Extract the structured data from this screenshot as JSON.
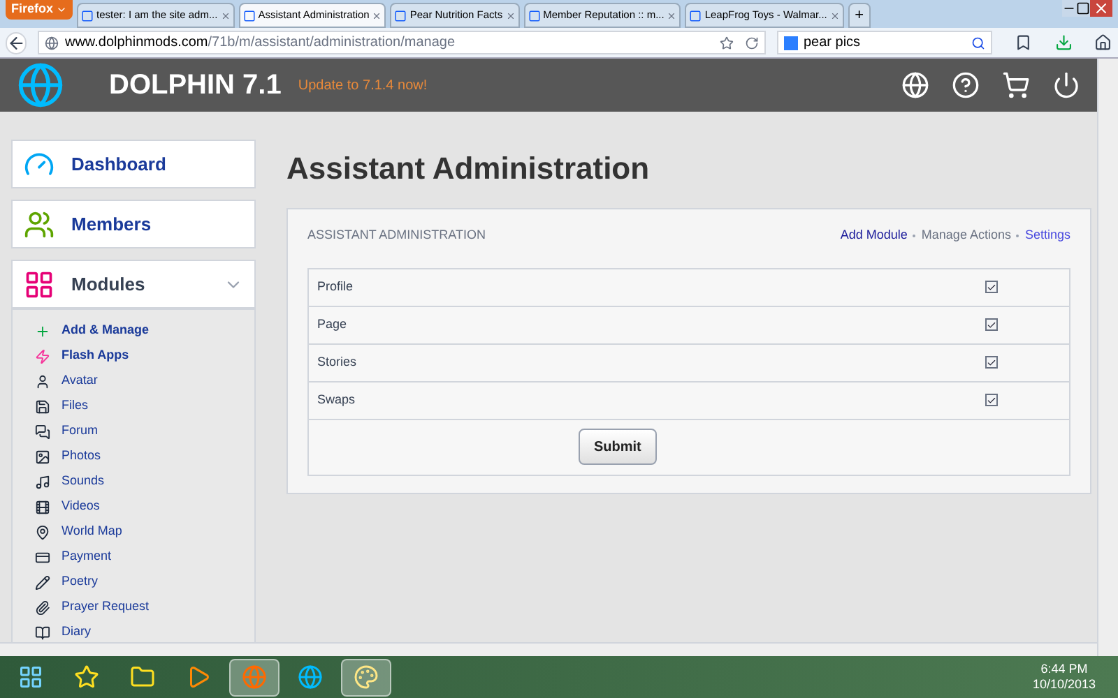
{
  "browser": {
    "menu_button": "Firefox",
    "tabs": [
      {
        "label": "tester: I am the site adm...",
        "selected": false
      },
      {
        "label": "Assistant Administration",
        "selected": true
      },
      {
        "label": "Pear Nutrition Facts",
        "selected": false
      },
      {
        "label": "Member Reputation :: m...",
        "selected": false
      },
      {
        "label": "LeapFrog Toys - Walmar...",
        "selected": false
      }
    ],
    "new_tab": "+",
    "address": {
      "domain": "www.dolphinmods.com",
      "path": "/71b/m/assistant/administration/manage"
    },
    "search": {
      "value": "pear pics"
    }
  },
  "header": {
    "logo_text": "DOLPHIN 7.1",
    "update_link": "Update to 7.1.4 now!"
  },
  "sidebar": {
    "sections": [
      {
        "label": "Dashboard"
      },
      {
        "label": "Members"
      },
      {
        "label": "Modules",
        "expanded": true
      }
    ],
    "items": [
      {
        "label": "Add & Manage",
        "emphasized": true
      },
      {
        "label": "Flash Apps",
        "emphasized": true
      },
      {
        "label": "Avatar",
        "emphasized": false
      },
      {
        "label": "Files",
        "emphasized": false
      },
      {
        "label": "Forum",
        "emphasized": false
      },
      {
        "label": "Photos",
        "emphasized": false
      },
      {
        "label": "Sounds",
        "emphasized": false
      },
      {
        "label": "Videos",
        "emphasized": false
      },
      {
        "label": "World Map",
        "emphasized": false
      },
      {
        "label": "Payment",
        "emphasized": false
      },
      {
        "label": "Poetry",
        "emphasized": false
      },
      {
        "label": "Prayer Request",
        "emphasized": false
      },
      {
        "label": "Diary",
        "emphasized": false
      }
    ]
  },
  "page": {
    "title": "Assistant Administration",
    "panel": {
      "heading": "ASSISTANT ADMINISTRATION",
      "actions": [
        {
          "label": "Add Module",
          "selected": true
        },
        {
          "label": "Manage Actions",
          "selected": false
        },
        {
          "label": "Settings",
          "selected": false
        }
      ],
      "rows": [
        {
          "label": "Profile",
          "checked": true
        },
        {
          "label": "Page",
          "checked": true
        },
        {
          "label": "Stories",
          "checked": true
        },
        {
          "label": "Swaps",
          "checked": true
        }
      ],
      "submit": "Submit"
    }
  },
  "taskbar": {
    "apps": [
      {
        "kind": "start",
        "selected": false
      },
      {
        "kind": "launcher",
        "selected": false
      },
      {
        "kind": "folder",
        "selected": false
      },
      {
        "kind": "media",
        "selected": false
      },
      {
        "kind": "browser",
        "selected": true
      },
      {
        "kind": "ie",
        "selected": false
      },
      {
        "kind": "paint",
        "selected": true
      }
    ],
    "time": "6:44 PM",
    "date": "10/10/2013"
  }
}
